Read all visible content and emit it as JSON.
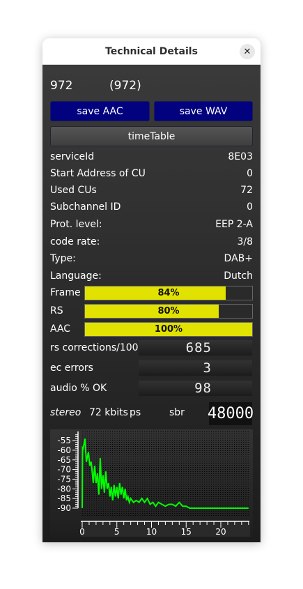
{
  "window": {
    "title": "Technical Details",
    "close_icon": "close-icon"
  },
  "header": {
    "frequency": "972",
    "frequency_paren": "(972)"
  },
  "buttons": {
    "save_aac": "save AAC",
    "save_wav": "save WAV",
    "time_table": "timeTable"
  },
  "details": [
    {
      "label": "serviceId",
      "value": "8E03"
    },
    {
      "label": "Start Address of CU",
      "value": "0"
    },
    {
      "label": "Used CUs",
      "value": "72"
    },
    {
      "label": "Subchannel ID",
      "value": "0"
    },
    {
      "label": "Prot. level:",
      "value": "EEP 2-A"
    },
    {
      "label": "code rate:",
      "value": "3/8"
    },
    {
      "label": "Type:",
      "value": "DAB+"
    },
    {
      "label": "Language:",
      "value": "Dutch"
    }
  ],
  "bars": [
    {
      "label": "Frame",
      "text": "84%",
      "percent": 84
    },
    {
      "label": "RS",
      "text": "80%",
      "percent": 80
    },
    {
      "label": "AAC",
      "text": "100%",
      "percent": 100
    }
  ],
  "counters": [
    {
      "label": "rs corrections/100",
      "value": "685"
    },
    {
      "label": "ec errors",
      "value": "3"
    },
    {
      "label": "audio % OK",
      "value": "98"
    }
  ],
  "audio": {
    "mode": "stereo",
    "bitrate": "72 kbits",
    "ps": "ps",
    "sbr": "sbr",
    "sample_rate": "48000"
  },
  "colors": {
    "bar_fill": "#e2e200",
    "button_blue": "#02027f",
    "spectrum": "#00ff00"
  },
  "chart_data": {
    "type": "line",
    "xlim": [
      0,
      24
    ],
    "ylim": [
      -90,
      -52
    ],
    "xticks": [
      "0",
      "5",
      "10",
      "15",
      "20"
    ],
    "yticks": [
      "-55",
      "-60",
      "-65",
      "-70",
      "-75",
      "-80",
      "-85",
      "-90"
    ],
    "grid": true,
    "series": [
      {
        "x": [
          0,
          0.05,
          0.1,
          0.4,
          0.6,
          0.9,
          1.1,
          1.3,
          1.6,
          1.8,
          2.0,
          2.2,
          2.4,
          2.6,
          2.8,
          3.0,
          3.2,
          3.4,
          3.6,
          3.8,
          4.0,
          4.2,
          4.4,
          4.6,
          4.8,
          5.0,
          5.2,
          5.4,
          5.6,
          5.8,
          6.0,
          6.2,
          6.4,
          6.6,
          6.8,
          7.0,
          7.4,
          7.8,
          8.2,
          8.6,
          9.0,
          9.4,
          9.8,
          10.2,
          10.6,
          11,
          11.5,
          12,
          12.5,
          13,
          13.5,
          14,
          14.5,
          15,
          15.5,
          16,
          24
        ],
        "y": [
          -90,
          -58,
          -60,
          -54,
          -66,
          -61,
          -68,
          -66,
          -77,
          -68,
          -77,
          -72,
          -83,
          -64,
          -80,
          -73,
          -82,
          -71,
          -80,
          -77,
          -84,
          -79,
          -86,
          -78,
          -84,
          -79,
          -85,
          -77,
          -83,
          -79,
          -85,
          -80,
          -86,
          -84,
          -87,
          -85,
          -87,
          -86,
          -87,
          -85,
          -87,
          -85,
          -88,
          -87,
          -89,
          -87,
          -88,
          -89,
          -88,
          -88,
          -89,
          -87,
          -89,
          -89,
          -90,
          -90,
          -90
        ]
      }
    ]
  }
}
